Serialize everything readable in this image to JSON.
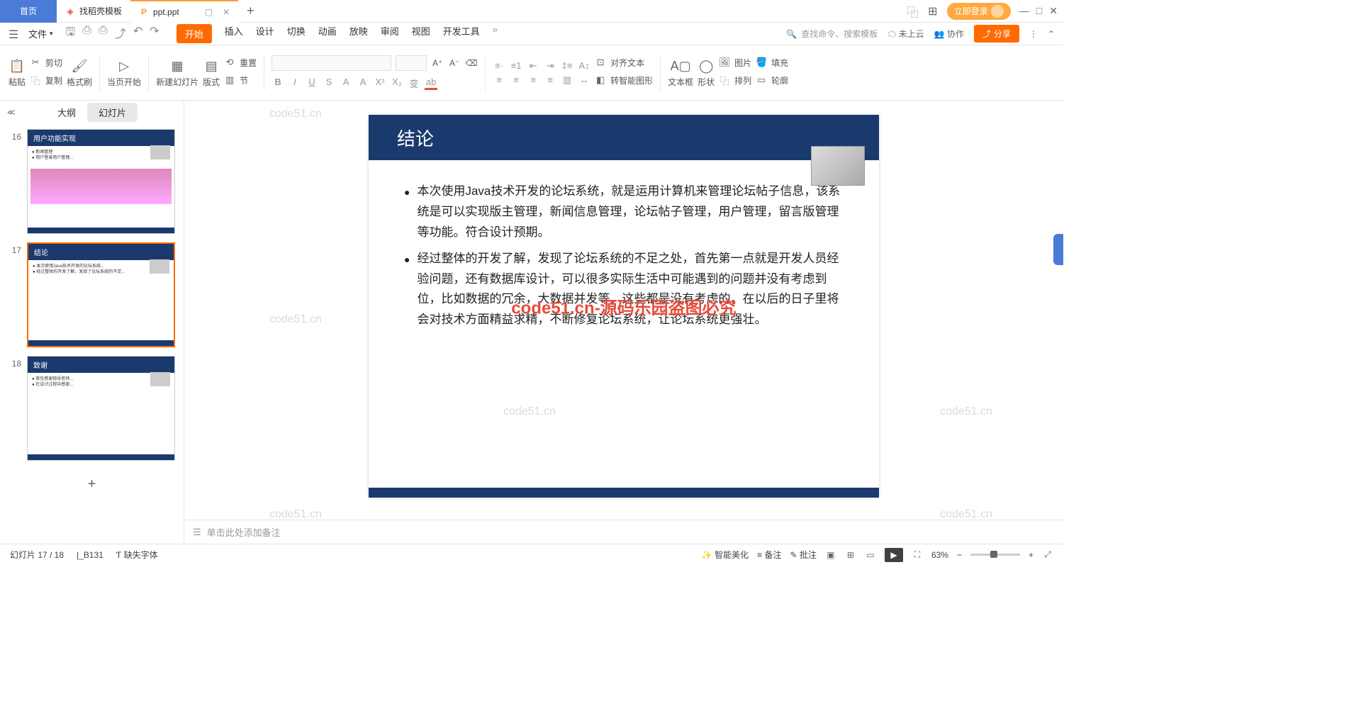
{
  "titlebar": {
    "home_tab": "首页",
    "template_tab": "找稻壳模板",
    "file_tab": "ppt.ppt",
    "login": "立即登录"
  },
  "menubar": {
    "file": "文件",
    "items": [
      "开始",
      "插入",
      "设计",
      "切换",
      "动画",
      "放映",
      "审阅",
      "视图",
      "开发工具"
    ],
    "search_placeholder": "查找命令、搜索模板",
    "cloud": "未上云",
    "collab": "协作",
    "share": "分享"
  },
  "ribbon": {
    "paste": "粘贴",
    "cut": "剪切",
    "copy": "复制",
    "format_painter": "格式刷",
    "from_current": "当页开始",
    "new_slide": "新建幻灯片",
    "layout": "版式",
    "section": "节",
    "reset": "重置",
    "align_text": "对齐文本",
    "smart_graphic": "转智能图形",
    "textbox": "文本框",
    "shape": "形状",
    "image": "图片",
    "arrange": "排列",
    "fill": "填充",
    "outline": "轮廓"
  },
  "thumb_panel": {
    "outline_tab": "大纲",
    "slides_tab": "幻灯片",
    "slides": [
      {
        "num": "16",
        "title": "用户功能实现"
      },
      {
        "num": "17",
        "title": "结论"
      },
      {
        "num": "18",
        "title": "致谢"
      }
    ]
  },
  "slide": {
    "title": "结论",
    "bullets": [
      "本次使用Java技术开发的论坛系统，就是运用计算机来管理论坛帖子信息，该系统是可以实现版主管理，新闻信息管理，论坛帖子管理，用户管理，留言版管理等功能。符合设计预期。",
      "经过整体的开发了解，发现了论坛系统的不足之处，首先第一点就是开发人员经验问题，还有数据库设计，可以很多实际生活中可能遇到的问题并没有考虑到位，比如数据的冗余，大数据并发等，这些都是没有考虑的，在以后的日子里将会对技术方面精益求精，不断修复论坛系统，让论坛系统更强壮。"
    ]
  },
  "watermarks": {
    "text": "code51.cn",
    "center": "code51.cn-源码乐园盗图必究"
  },
  "notes": {
    "placeholder": "单击此处添加备注"
  },
  "statusbar": {
    "slide_info": "幻灯片 17 / 18",
    "marker": "|_B131",
    "missing_font": "缺失字体",
    "smart_beautify": "智能美化",
    "notes_btn": "备注",
    "comments_btn": "批注",
    "zoom": "63%"
  }
}
